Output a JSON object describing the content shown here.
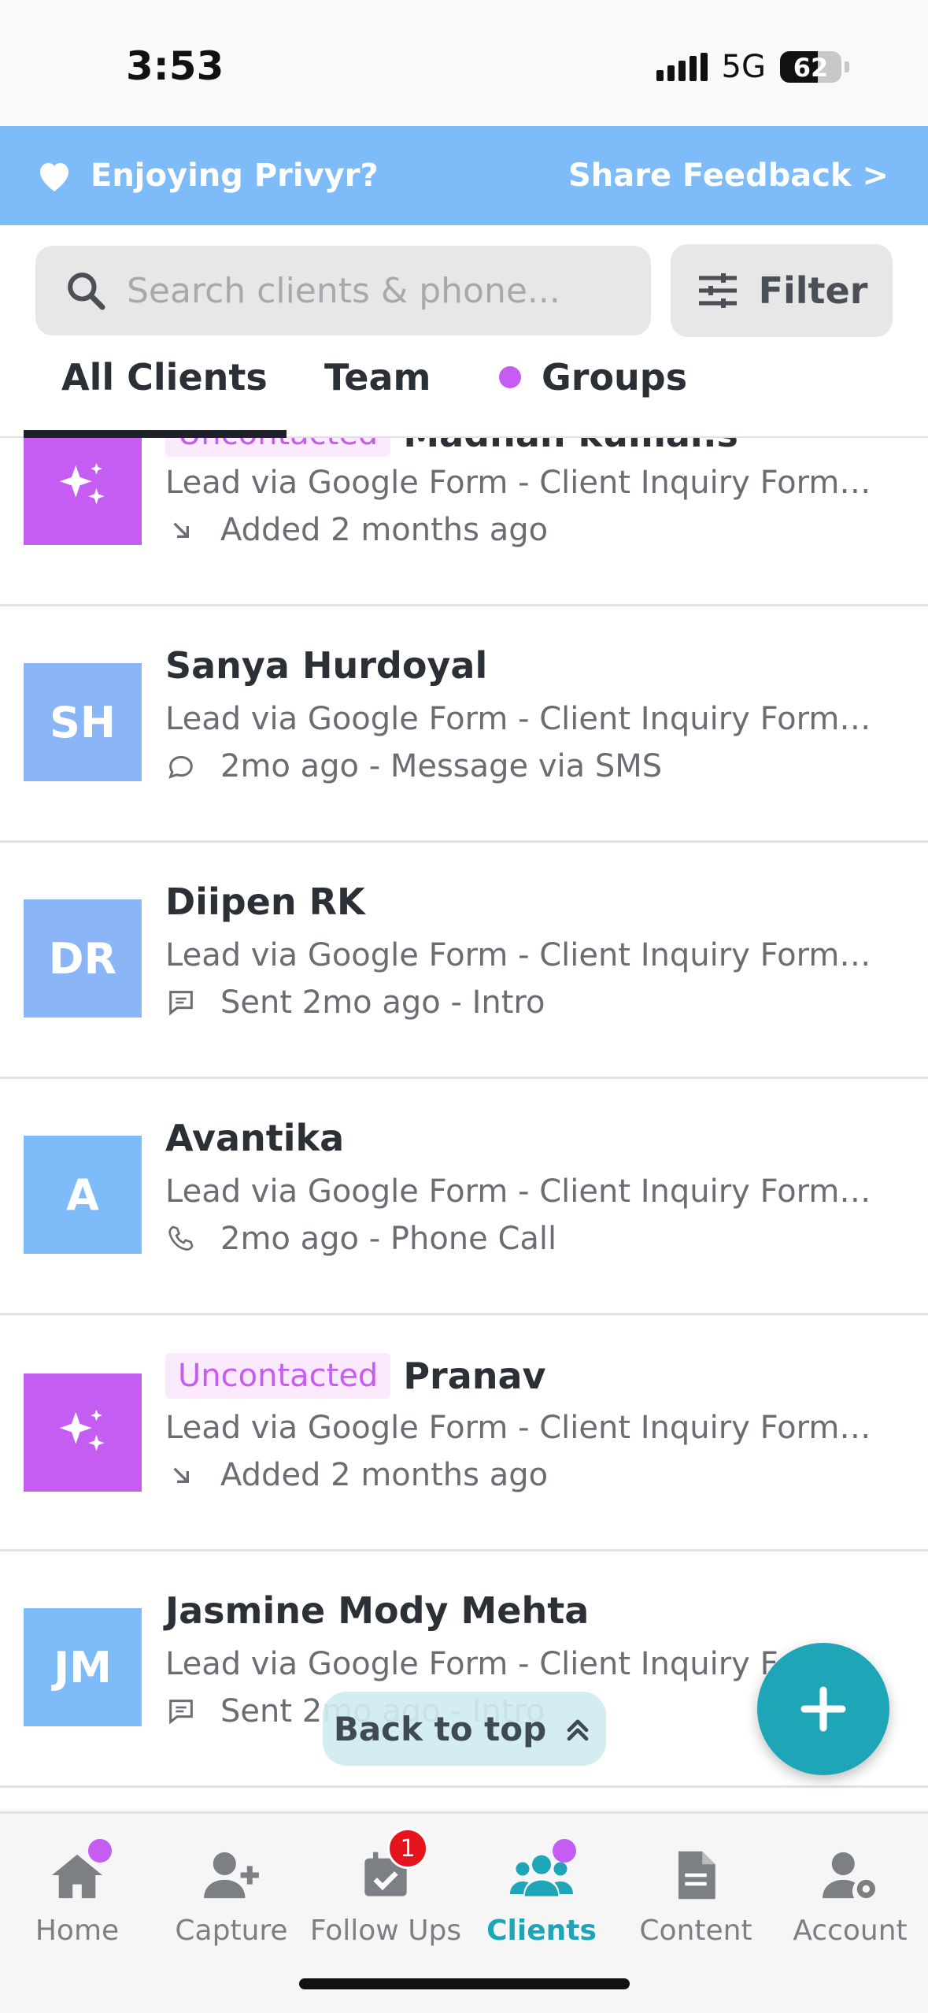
{
  "status_bar": {
    "time": "3:53",
    "network": "5G",
    "battery": "62",
    "battery_level": 0.62
  },
  "banner": {
    "text": "Enjoying Privyr?",
    "link": "Share Feedback  >"
  },
  "search": {
    "placeholder": "Search clients & phone...",
    "filter_label": "Filter"
  },
  "tabs": [
    {
      "label": "All Clients",
      "active": true
    },
    {
      "label": "Team",
      "active": false
    },
    {
      "label": "Groups",
      "active": false
    }
  ],
  "clients": [
    {
      "initials": "",
      "name": "Madhan kumar.s",
      "badge": "Uncontacted",
      "source": "Lead via Google Form - Client Inquiry Form f...",
      "activity": "Added 2 months ago",
      "activity_icon": "arrow-down-right-icon"
    },
    {
      "initials": "SH",
      "name": "Sanya Hurdoyal",
      "badge": "",
      "source": "Lead via Google Form - Client Inquiry Form f...",
      "activity": "2mo ago - Message via SMS",
      "activity_icon": "chat-bubble-icon"
    },
    {
      "initials": "DR",
      "name": "Diipen RK",
      "badge": "",
      "source": "Lead via Google Form - Client Inquiry Form f...",
      "activity": "Sent 2mo ago - Intro",
      "activity_icon": "message-square-icon"
    },
    {
      "initials": "A",
      "name": "Avantika",
      "badge": "",
      "source": "Lead via Google Form - Client Inquiry Form f...",
      "activity": "2mo ago - Phone Call",
      "activity_icon": "phone-icon"
    },
    {
      "initials": "",
      "name": "Pranav",
      "badge": "Uncontacted",
      "source": "Lead via Google Form - Client Inquiry Form f...",
      "activity": "Added 2 months ago",
      "activity_icon": "arrow-down-right-icon"
    },
    {
      "initials": "JM",
      "name": "Jasmine Mody Mehta",
      "badge": "",
      "source": "Lead via Google Form - Client Inquiry Form f...",
      "activity": "Sent 2mo ago - Intro",
      "activity_icon": "message-square-icon"
    }
  ],
  "back_to_top": "Back to top",
  "bottom_nav": [
    {
      "label": "Home",
      "active": false
    },
    {
      "label": "Capture",
      "active": false
    },
    {
      "label": "Follow Ups",
      "active": false,
      "count": "1"
    },
    {
      "label": "Clients",
      "active": true
    },
    {
      "label": "Content",
      "active": false
    },
    {
      "label": "Account",
      "active": false
    }
  ],
  "colors": {
    "accent": "#1ea5b7",
    "banner": "#7dbcf8",
    "purple": "#c65df2",
    "badge_bg": "#fbe9fd",
    "alert": "#e5141d"
  }
}
